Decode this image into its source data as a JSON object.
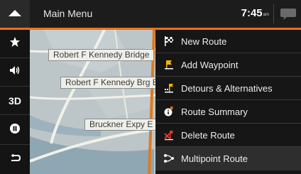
{
  "header": {
    "title": "Main Menu",
    "time": "7:45",
    "ampm": "am",
    "up_icon": "up-arrow-icon",
    "message_icon": "message-bubble-icon"
  },
  "sidebar": {
    "items": [
      {
        "icon": "star-icon",
        "label": ""
      },
      {
        "icon": "volume-icon",
        "label": ""
      },
      {
        "icon": "view-mode-icon",
        "label": "3D"
      },
      {
        "icon": "pause-icon",
        "label": ""
      },
      {
        "icon": "back-icon",
        "label": ""
      }
    ]
  },
  "map": {
    "road_labels": [
      "Robert F Kennedy Bridge",
      "Robert F Kennedy Brg E",
      "Bruckner Expy E"
    ]
  },
  "menu": {
    "items": [
      {
        "label": "New Route",
        "icon": "checkered-flag-icon"
      },
      {
        "label": "Add Waypoint",
        "icon": "waypoint-flag-icon"
      },
      {
        "label": "Detours & Alternatives",
        "icon": "detour-icon"
      },
      {
        "label": "Route Summary",
        "icon": "route-summary-icon"
      },
      {
        "label": "Delete Route",
        "icon": "delete-route-icon"
      },
      {
        "label": "Multipoint Route",
        "icon": "multipoint-route-icon"
      }
    ],
    "selected_index": 5
  },
  "colors": {
    "accent": "#e8721c",
    "header_bg": "#1c1c1c",
    "menu_bg": "#161616",
    "map_bg": "#b9c3c6",
    "route": "#e07a1f",
    "icon_red": "#e23a2a",
    "icon_yellow": "#f2b705"
  }
}
